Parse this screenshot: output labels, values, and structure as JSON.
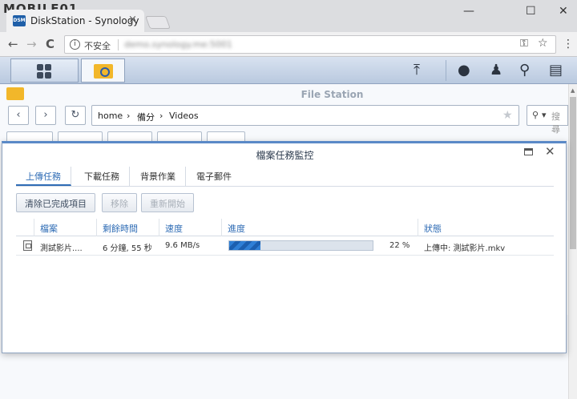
{
  "browser": {
    "watermark": "MOBILE01",
    "tab_title": "DiskStation - Synology",
    "tab_close": "×",
    "favicon": "DSM",
    "window_controls": {
      "minimize": "—",
      "maximize": "☐",
      "close": "✕"
    },
    "nav": {
      "back": "←",
      "forward": "→",
      "reload": "C"
    },
    "security_label": "不安全",
    "url": "demo.synology.me:5001",
    "key_icon": "⚿",
    "star_icon": "☆",
    "menu_icon": "⋮"
  },
  "dsm_taskbar": {
    "icons": [
      "main-menu-icon",
      "file-station-icon",
      "upload-icon",
      "chat-icon",
      "user-icon",
      "search-icon",
      "widgets-icon"
    ]
  },
  "file_station": {
    "title": "File Station",
    "path": {
      "segments": [
        "home",
        "備分",
        "Videos"
      ],
      "separator": "›"
    },
    "search_placeholder": "搜尋"
  },
  "task_monitor": {
    "title": "檔案任務監控",
    "tabs": [
      "上傳任務",
      "下載任務",
      "背景作業",
      "電子郵件"
    ],
    "active_tab": 0,
    "actions": [
      {
        "label": "清除已完成項目",
        "enabled": true
      },
      {
        "label": "移除",
        "enabled": false
      },
      {
        "label": "重新開始",
        "enabled": false
      }
    ],
    "columns": [
      "檔案",
      "剩餘時間",
      "速度",
      "進度",
      "狀態"
    ],
    "rows": [
      {
        "file": "測試影片....",
        "remaining": "6 分鐘, 55 秒",
        "speed": "9.6 MB/s",
        "progress": 22,
        "progress_label": "22 %",
        "status": "上傳中: 測試影片.mkv"
      }
    ],
    "accent": "#2f6cb5"
  }
}
